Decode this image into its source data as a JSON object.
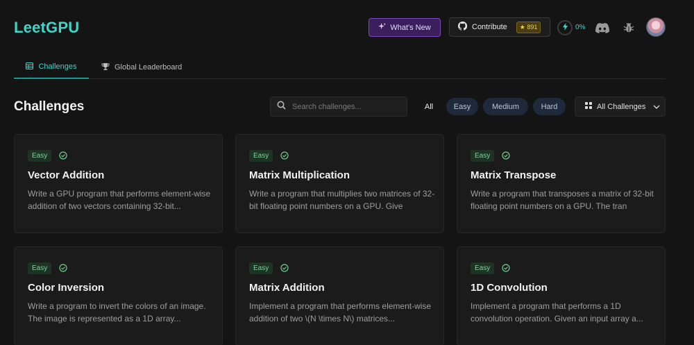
{
  "brand": {
    "logo": "LeetGPU",
    "accent": "#3ed6c8"
  },
  "header": {
    "whats_new": "What's New",
    "contribute": "Contribute",
    "stars": "★ 891",
    "progress": "0%"
  },
  "tabs": [
    {
      "label": "Challenges",
      "active": true
    },
    {
      "label": "Global Leaderboard",
      "active": false
    }
  ],
  "main": {
    "title": "Challenges",
    "search_placeholder": "Search challenges...",
    "filters": [
      "All",
      "Easy",
      "Medium",
      "Hard"
    ],
    "dropdown": "All Challenges"
  },
  "cards": [
    {
      "difficulty": "Easy",
      "title": "Vector Addition",
      "desc": "Write a GPU program that performs element-wise addition of two vectors containing 32-bit..."
    },
    {
      "difficulty": "Easy",
      "title": "Matrix Multiplication",
      "desc": "Write a program that multiplies two matrices of 32-bit floating point numbers on a GPU. Give"
    },
    {
      "difficulty": "Easy",
      "title": "Matrix Transpose",
      "desc": "Write a program that transposes a matrix of 32-bit floating point numbers on a GPU. The tran"
    },
    {
      "difficulty": "Easy",
      "title": "Color Inversion",
      "desc": "Write a program to invert the colors of an image. The image is represented as a 1D array..."
    },
    {
      "difficulty": "Easy",
      "title": "Matrix Addition",
      "desc": "Implement a program that performs element-wise addition of two \\(N \\times N\\) matrices..."
    },
    {
      "difficulty": "Easy",
      "title": "1D Convolution",
      "desc": "Implement a program that performs a 1D convolution operation. Given an input array a..."
    }
  ]
}
